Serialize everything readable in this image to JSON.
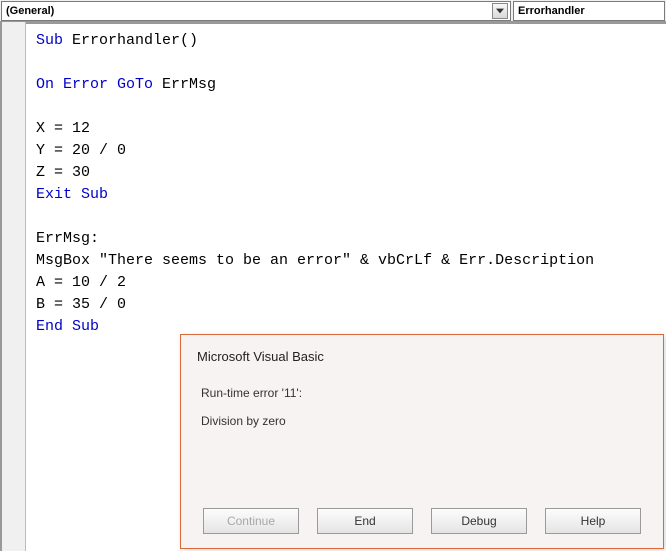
{
  "dropdowns": {
    "object": "(General)",
    "procedure": "Errorhandler"
  },
  "code": {
    "l1a": "Sub",
    "l1b": " Errorhandler()",
    "l2": "",
    "l3a": "On Error GoTo",
    "l3b": " ErrMsg",
    "l4": "",
    "l5": "X = 12",
    "l6": "Y = 20 / 0",
    "l7": "Z = 30",
    "l8": "Exit Sub",
    "l9": "",
    "l10": "ErrMsg:",
    "l11": "MsgBox \"There seems to be an error\" & vbCrLf & Err.Description",
    "l12": "A = 10 / 2",
    "l13": "B = 35 / 0",
    "l14": "End Sub"
  },
  "dialog": {
    "title": "Microsoft Visual Basic",
    "error_line": "Run-time error '11':",
    "error_msg": "Division by zero",
    "buttons": {
      "continue": "Continue",
      "end": "End",
      "debug": "Debug",
      "help": "Help"
    }
  }
}
